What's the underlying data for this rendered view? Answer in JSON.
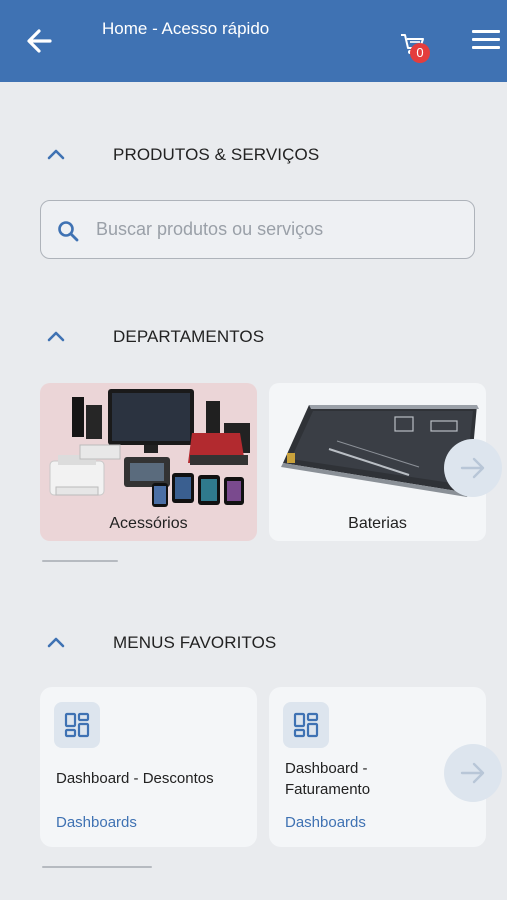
{
  "header": {
    "title": "Home - Acesso rápido",
    "cart_count": "0",
    "brand_color": "#3f72b3"
  },
  "sections": {
    "products": {
      "title": "PRODUTOS & SERVIÇOS"
    },
    "departments": {
      "title": "DEPARTAMENTOS"
    },
    "favorites": {
      "title": "MENUS FAVORITOS"
    }
  },
  "search": {
    "placeholder": "Buscar produtos ou serviços",
    "value": ""
  },
  "departments": [
    {
      "label": "Acessórios",
      "icon": "electronics-image"
    },
    {
      "label": "Baterias",
      "icon": "battery-image"
    }
  ],
  "favorites": [
    {
      "title": "Dashboard - Descontos",
      "category": "Dashboards",
      "icon": "dashboard-icon"
    },
    {
      "title": "Dashboard - Faturamento",
      "category": "Dashboards",
      "icon": "dashboard-icon"
    }
  ]
}
